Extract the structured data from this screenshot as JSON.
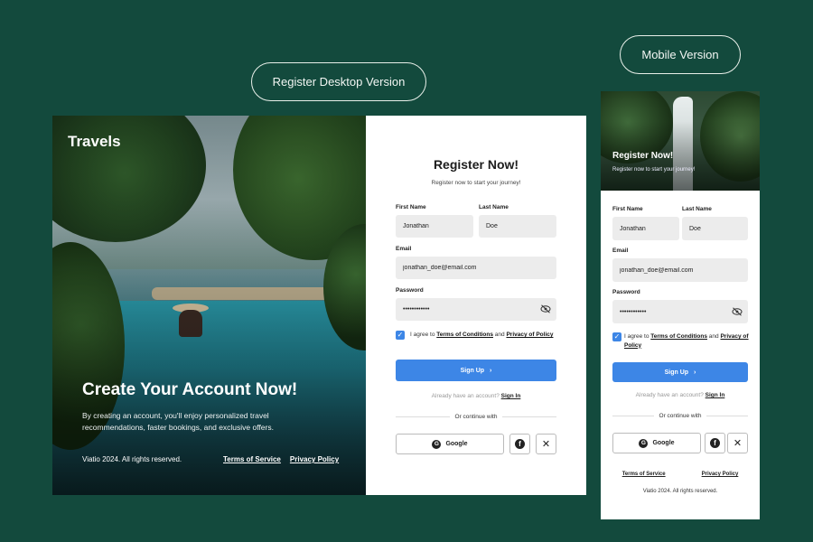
{
  "labels": {
    "desktop_version": "Register Desktop Version",
    "mobile_version": "Mobile Version"
  },
  "hero": {
    "brand": "Travels",
    "title": "Create Your Account Now!",
    "subtitle": "By creating an account, you'll enjoy personalized travel recommendations, faster bookings, and exclusive offers.",
    "copyright": "Viatio 2024. All rights reserved.",
    "terms": "Terms of Service",
    "privacy": "Privacy Policy"
  },
  "form": {
    "title": "Register Now!",
    "subtitle": "Register now to start your journey!",
    "first_name_label": "First Name",
    "first_name_value": "Jonathan",
    "last_name_label": "Last Name",
    "last_name_value": "Doe",
    "email_label": "Email",
    "email_value": "jonathan_doe@email.com",
    "password_label": "Password",
    "password_value": "••••••••••••",
    "agree_prefix": "I agree to ",
    "terms_link": "Terms of Conditions",
    "agree_and": " and ",
    "privacy_link": "Privacy of Policy",
    "signup": "Sign Up",
    "already": "Already have an account?",
    "signin": "Sign In",
    "or_continue": "Or continue with",
    "google": "Google"
  },
  "mobile": {
    "title": "Register Now!",
    "subtitle": "Register now to start your journey!",
    "terms": "Terms of Service",
    "privacy": "Privacy Policy",
    "copyright": "Viatio 2024. All rights reserved."
  },
  "icons": {
    "eye": "eye-slash-icon",
    "check": "checkmark-icon",
    "chevron": "chevron-right-icon",
    "google": "google-icon",
    "facebook": "facebook-icon",
    "x": "x-icon"
  },
  "colors": {
    "background": "#134a3d",
    "primary": "#3d86e6",
    "input_bg": "#ececec"
  }
}
